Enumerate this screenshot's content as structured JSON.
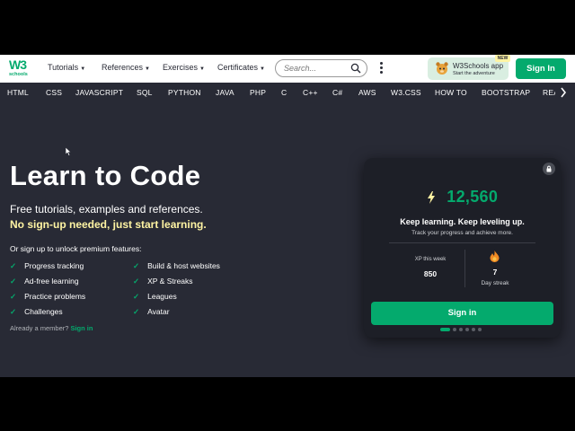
{
  "brand": {
    "logo_text": "W3",
    "logo_sub": "schools",
    "green": "#04aa6d",
    "dark": "#282a35",
    "yellow": "#fff4a3"
  },
  "topnav": {
    "menus": [
      "Tutorials",
      "References",
      "Exercises",
      "Certificates"
    ],
    "search": {
      "placeholder": "Search..."
    },
    "app": {
      "title": "W3Schools app",
      "subtitle": "Start the adventure",
      "badge": "NEW"
    },
    "signin": "Sign In"
  },
  "subnav": [
    "HTML",
    "CSS",
    "JAVASCRIPT",
    "SQL",
    "PYTHON",
    "JAVA",
    "PHP",
    "C",
    "C++",
    "C#",
    "AWS",
    "W3.CSS",
    "HOW TO",
    "BOOTSTRAP",
    "REA"
  ],
  "hero": {
    "title": "Learn to Code",
    "subtitle": "Free tutorials, examples and references.",
    "highlight": "No sign-up needed, just start learning.",
    "unlock": "Or sign up to unlock premium features:",
    "features_left": [
      "Progress tracking",
      "Ad-free learning",
      "Practice problems",
      "Challenges"
    ],
    "features_right": [
      "Build & host websites",
      "XP & Streaks",
      "Leagues",
      "Avatar"
    ],
    "member_text": "Already a member?",
    "member_link": "Sign in"
  },
  "card": {
    "xp": "12,560",
    "heading": "Keep learning. Keep leveling up.",
    "subheading": "Track your progress and achieve more.",
    "stat1_label": "XP this week",
    "stat1_value": "850",
    "stat2_value": "7",
    "stat2_label": "Day streak",
    "button": "Sign in",
    "carousel_active": 1,
    "carousel_total": 6
  },
  "icons": [
    "lock-icon",
    "bolt-icon",
    "flame-icon",
    "search-icon",
    "check-icon",
    "chevron-right-icon",
    "kebab-menu-icon",
    "mascot-icon"
  ]
}
